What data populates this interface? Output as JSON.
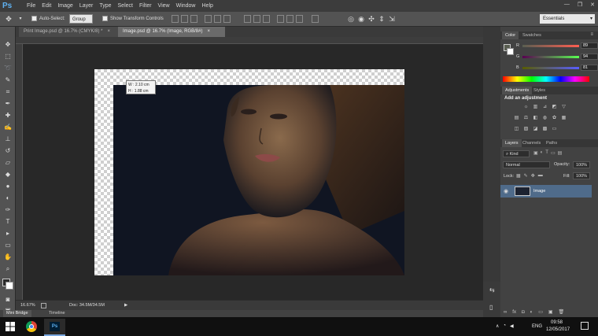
{
  "app": {
    "logo": "Ps",
    "menu": [
      "File",
      "Edit",
      "Image",
      "Layer",
      "Type",
      "Select",
      "Filter",
      "View",
      "Window",
      "Help"
    ],
    "window_controls": [
      "—",
      "❐",
      "✕"
    ]
  },
  "options_bar": {
    "auto_select_label": "Auto-Select:",
    "auto_select_value": "Group",
    "show_transform_label": "Show Transform Controls",
    "workspace": "Essentials"
  },
  "doc_tabs": [
    {
      "label": "Print Image.psd @ 16.7% (CMYK/8) *",
      "active": false
    },
    {
      "label": "Image.psd @ 16.7% (Image, RGB/8#)",
      "active": true
    }
  ],
  "measure_tooltip": {
    "w": "W :  2.10 cm",
    "h": "H :  1.88 cm"
  },
  "status": {
    "zoom": "16.67%",
    "doc": "Doc: 34.5M/34.5M"
  },
  "bottom_tabs": [
    "Mini Bridge",
    "Timeline"
  ],
  "color_panel": {
    "tabs": [
      "Color",
      "Swatches"
    ],
    "channels": [
      {
        "letter": "R",
        "value": "89",
        "gradient": "#c00000"
      },
      {
        "letter": "G",
        "value": "94",
        "gradient": "#00a000"
      },
      {
        "letter": "B",
        "value": "81",
        "gradient": "#0030c0"
      }
    ],
    "fg_color": "#595e51"
  },
  "adjustments_panel": {
    "tabs": [
      "Adjustments",
      "Styles"
    ],
    "title": "Add an adjustment"
  },
  "layers_panel": {
    "tabs": [
      "Layers",
      "Channels",
      "Paths"
    ],
    "kind": "Kind",
    "blend_mode": "Normal",
    "opacity_label": "Opacity:",
    "opacity": "100%",
    "lock_label": "Lock:",
    "fill_label": "Fill:",
    "fill": "100%",
    "layers": [
      {
        "name": "Image",
        "visible": true
      }
    ]
  },
  "taskbar": {
    "language": "ENG",
    "time": "09:58",
    "date": "12/05/2017"
  },
  "colors": {
    "accent": "#4f6b8a",
    "ps_blue": "#5fb1f0"
  }
}
